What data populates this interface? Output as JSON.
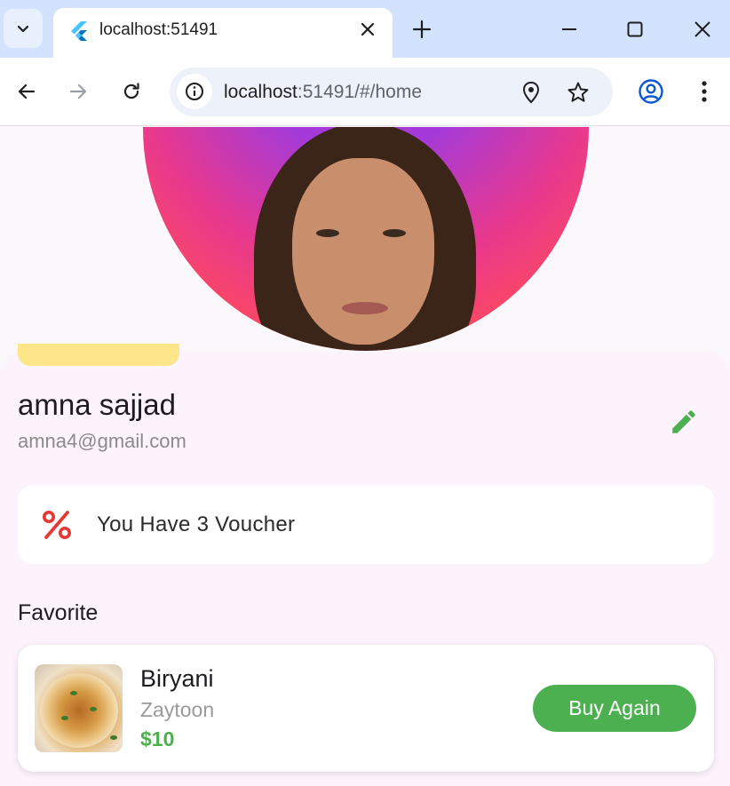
{
  "browser": {
    "tab_title": "localhost:51491",
    "url_host": "localhost",
    "url_rest": ":51491/#/home",
    "icons": {
      "tab_search": "chevron-down-icon",
      "favicon": "flutter-icon",
      "close_tab": "close-icon",
      "new_tab": "plus-icon",
      "minimize": "minimize-icon",
      "maximize": "maximize-icon",
      "close_window": "close-icon",
      "back": "arrow-left-icon",
      "forward": "arrow-right-icon",
      "reload": "reload-icon",
      "site_info": "info-icon",
      "location": "location-pin-icon",
      "bookmark": "star-icon",
      "profile": "account-icon",
      "menu": "more-vert-icon"
    }
  },
  "profile": {
    "name": "amna sajjad",
    "email": "amna4@gmail.com",
    "edit_icon": "pencil-icon"
  },
  "voucher": {
    "icon": "percent-icon",
    "text": "You Have 3 Voucher",
    "color": "#e53935"
  },
  "favorites": {
    "title": "Favorite",
    "items": [
      {
        "name": "Biryani",
        "shop": "Zaytoon",
        "price": "$10",
        "button": "Buy Again"
      }
    ]
  },
  "colors": {
    "accent": "#4caf50",
    "sheet_bg": "#fdf3fd",
    "tabbar_bg": "#d3e3fd"
  }
}
